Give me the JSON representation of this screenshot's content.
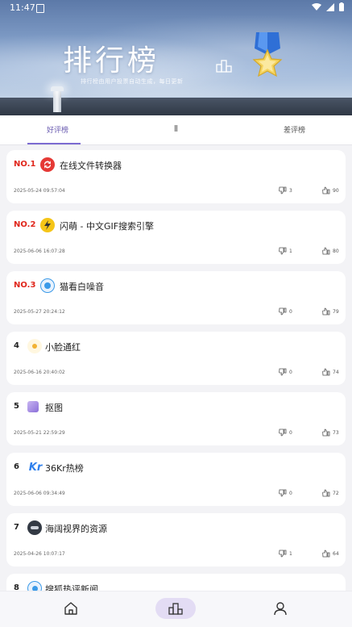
{
  "status_bar": {
    "time": "11:47"
  },
  "hero": {
    "title": "排行榜",
    "subtitle": "排行榜由用户投票自动生成，每日更新"
  },
  "tabs": [
    {
      "label": "好评榜",
      "active": true
    },
    {
      "label": "差评榜",
      "active": false
    }
  ],
  "items": [
    {
      "rank": "NO.1",
      "name": "在线文件转换器",
      "date": "2025-05-24 09:57:04",
      "dislikes": "3",
      "likes": "90",
      "icon": "convert-icon",
      "icon_color": "#e53935"
    },
    {
      "rank": "NO.2",
      "name": "闪萌 - 中文GIF搜索引擎",
      "date": "2025-06-06 16:07:28",
      "dislikes": "1",
      "likes": "80",
      "icon": "lightning-icon",
      "icon_color": "#f5c518"
    },
    {
      "rank": "NO.3",
      "name": "猫看白噪音",
      "date": "2025-05-27 20:24:12",
      "dislikes": "0",
      "likes": "79",
      "icon": "circle-icon",
      "icon_color": "#3b9ae8"
    },
    {
      "rank": "4",
      "name": "小脸通红",
      "date": "2025-06-16 20:40:02",
      "dislikes": "0",
      "likes": "74",
      "icon": "dot-icon",
      "icon_color": "#f2b233"
    },
    {
      "rank": "5",
      "name": "抠图",
      "date": "2025-05-21 22:59:29",
      "dislikes": "0",
      "likes": "73",
      "icon": "cutout-icon",
      "icon_color": "#9b7be0"
    },
    {
      "rank": "6",
      "name": "36Kr热榜",
      "date": "2025-06-06 09:34:49",
      "dislikes": "0",
      "likes": "72",
      "icon": "kr-icon",
      "icon_color": "#2f80ed"
    },
    {
      "rank": "7",
      "name": "海阔视界的资源",
      "date": "2025-04-26 10:07:17",
      "dislikes": "1",
      "likes": "64",
      "icon": "halo-icon",
      "icon_color": "#333a44"
    },
    {
      "rank": "8",
      "name": "搜狐热评新闻",
      "date": "",
      "dislikes": "",
      "likes": "",
      "icon": "circle-icon",
      "icon_color": "#3b9ae8"
    }
  ],
  "bottom_nav": [
    {
      "name": "home",
      "active": false
    },
    {
      "name": "ranking",
      "active": true
    },
    {
      "name": "profile",
      "active": false
    }
  ]
}
